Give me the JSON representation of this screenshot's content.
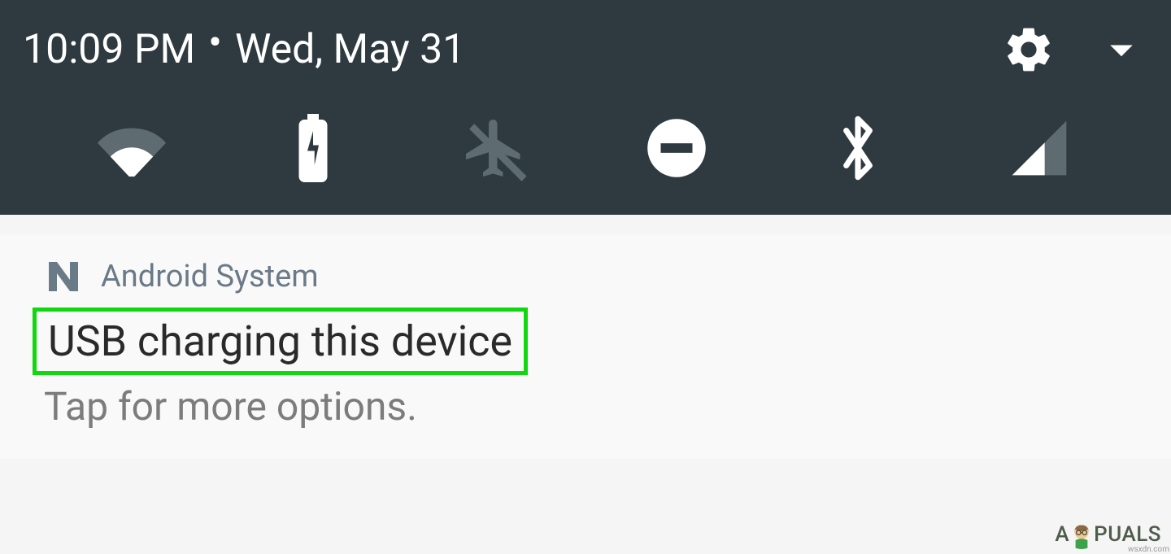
{
  "header": {
    "time": "10:09 PM",
    "date": "Wed, May 31"
  },
  "quick_settings": [
    {
      "name": "wifi",
      "enabled": true
    },
    {
      "name": "battery",
      "enabled": true
    },
    {
      "name": "airplane",
      "enabled": false
    },
    {
      "name": "dnd",
      "enabled": true
    },
    {
      "name": "bluetooth",
      "enabled": true
    },
    {
      "name": "cellular",
      "enabled": true
    }
  ],
  "notification": {
    "app_name": "Android System",
    "title": "USB charging this device",
    "subtitle": "Tap for more options."
  },
  "watermark": {
    "part1": "A",
    "part2": "PUALS"
  },
  "source": "wsxdn.com",
  "colors": {
    "shade_bg": "#2e3a40",
    "accent": "#0fd80f",
    "icon_dim": "#5e6b70",
    "notif_app": "#6b7a87"
  }
}
